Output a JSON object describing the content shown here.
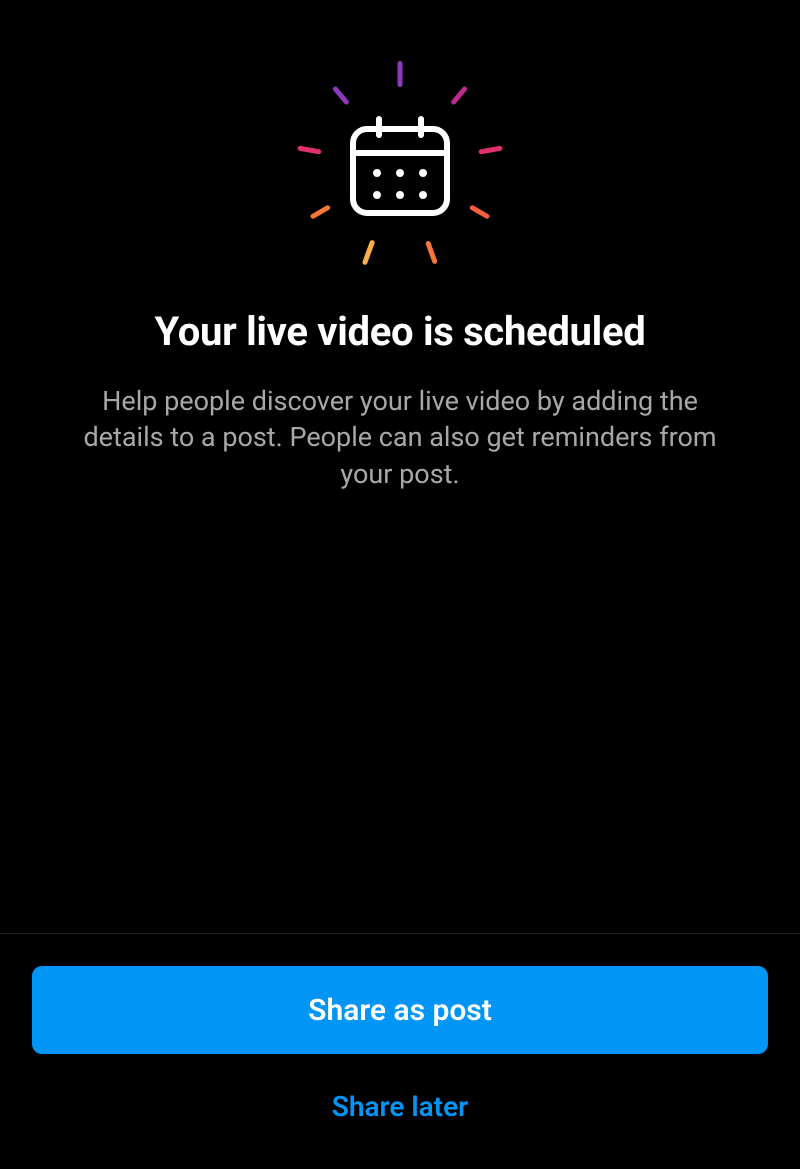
{
  "heading": "Your live video is scheduled",
  "subtext": "Help people discover your live video by adding the details to a post. People can also get reminders from your post.",
  "buttons": {
    "primary": "Share as post",
    "secondary": "Share later"
  },
  "icon": {
    "name": "calendar-celebration-icon"
  },
  "colors": {
    "primary": "#0095f6",
    "background": "#000000",
    "text_secondary": "#a8a8a8"
  }
}
